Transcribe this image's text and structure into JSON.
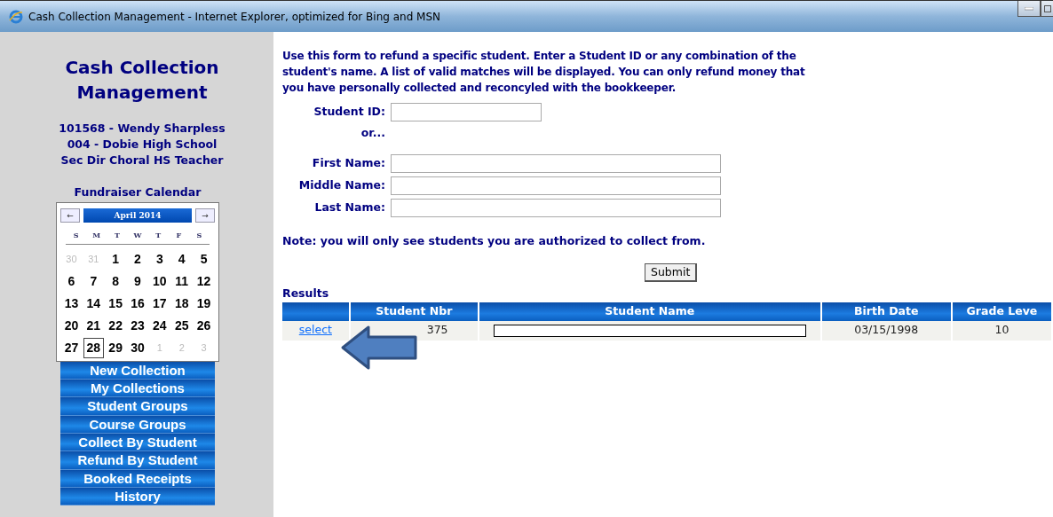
{
  "window": {
    "title": "Cash Collection Management - Internet Explorer, optimized for Bing and MSN"
  },
  "sidebar": {
    "app_title": "Cash Collection Management",
    "user_lines": [
      "101568 - Wendy Sharpless",
      "004 - Dobie High School",
      "Sec Dir Choral HS Teacher"
    ],
    "calendar": {
      "title": "Fundraiser Calendar",
      "prev": "←",
      "next": "→",
      "month": "April 2014",
      "weekdays": [
        "S",
        "M",
        "T",
        "W",
        "T",
        "F",
        "S"
      ],
      "days": [
        {
          "label": "30",
          "muted": true,
          "selected": false
        },
        {
          "label": "31",
          "muted": true,
          "selected": false
        },
        {
          "label": "1",
          "muted": false,
          "selected": false
        },
        {
          "label": "2",
          "muted": false,
          "selected": false
        },
        {
          "label": "3",
          "muted": false,
          "selected": false
        },
        {
          "label": "4",
          "muted": false,
          "selected": false
        },
        {
          "label": "5",
          "muted": false,
          "selected": false
        },
        {
          "label": "6",
          "muted": false,
          "selected": false
        },
        {
          "label": "7",
          "muted": false,
          "selected": false
        },
        {
          "label": "8",
          "muted": false,
          "selected": false
        },
        {
          "label": "9",
          "muted": false,
          "selected": false
        },
        {
          "label": "10",
          "muted": false,
          "selected": false
        },
        {
          "label": "11",
          "muted": false,
          "selected": false
        },
        {
          "label": "12",
          "muted": false,
          "selected": false
        },
        {
          "label": "13",
          "muted": false,
          "selected": false
        },
        {
          "label": "14",
          "muted": false,
          "selected": false
        },
        {
          "label": "15",
          "muted": false,
          "selected": false
        },
        {
          "label": "16",
          "muted": false,
          "selected": false
        },
        {
          "label": "17",
          "muted": false,
          "selected": false
        },
        {
          "label": "18",
          "muted": false,
          "selected": false
        },
        {
          "label": "19",
          "muted": false,
          "selected": false
        },
        {
          "label": "20",
          "muted": false,
          "selected": false
        },
        {
          "label": "21",
          "muted": false,
          "selected": false
        },
        {
          "label": "22",
          "muted": false,
          "selected": false
        },
        {
          "label": "23",
          "muted": false,
          "selected": false
        },
        {
          "label": "24",
          "muted": false,
          "selected": false
        },
        {
          "label": "25",
          "muted": false,
          "selected": false
        },
        {
          "label": "26",
          "muted": false,
          "selected": false
        },
        {
          "label": "27",
          "muted": false,
          "selected": false
        },
        {
          "label": "28",
          "muted": false,
          "selected": true
        },
        {
          "label": "29",
          "muted": false,
          "selected": false
        },
        {
          "label": "30",
          "muted": false,
          "selected": false
        },
        {
          "label": "1",
          "muted": true,
          "selected": false
        },
        {
          "label": "2",
          "muted": true,
          "selected": false
        },
        {
          "label": "3",
          "muted": true,
          "selected": false
        }
      ]
    },
    "menu": [
      "New Collection",
      "My Collections",
      "Student Groups",
      "Course Groups",
      "Collect By Student",
      "Refund By Student",
      "Booked Receipts",
      "History"
    ]
  },
  "form": {
    "intro": "Use this form to refund a specific student. Enter a Student ID or any combination of the student's name. A list of valid matches will be displayed. You can only refund money that you have personally collected and reconcyled with the bookkeeper.",
    "student_id_label": "Student ID:",
    "or_text": "or...",
    "name_fields": [
      {
        "label": "First Name:"
      },
      {
        "label": "Middle Name:"
      },
      {
        "label": "Last Name:"
      }
    ],
    "note": "Note: you will only see students you are authorized to collect from.",
    "submit": "Submit"
  },
  "results": {
    "title": "Results",
    "columns": [
      "Student Nbr",
      "Student Name",
      "Birth Date",
      "Grade Leve"
    ],
    "rows": [
      {
        "link": "select",
        "student_nbr": "375",
        "birth_date": "03/15/1998",
        "grade": "10"
      }
    ]
  }
}
